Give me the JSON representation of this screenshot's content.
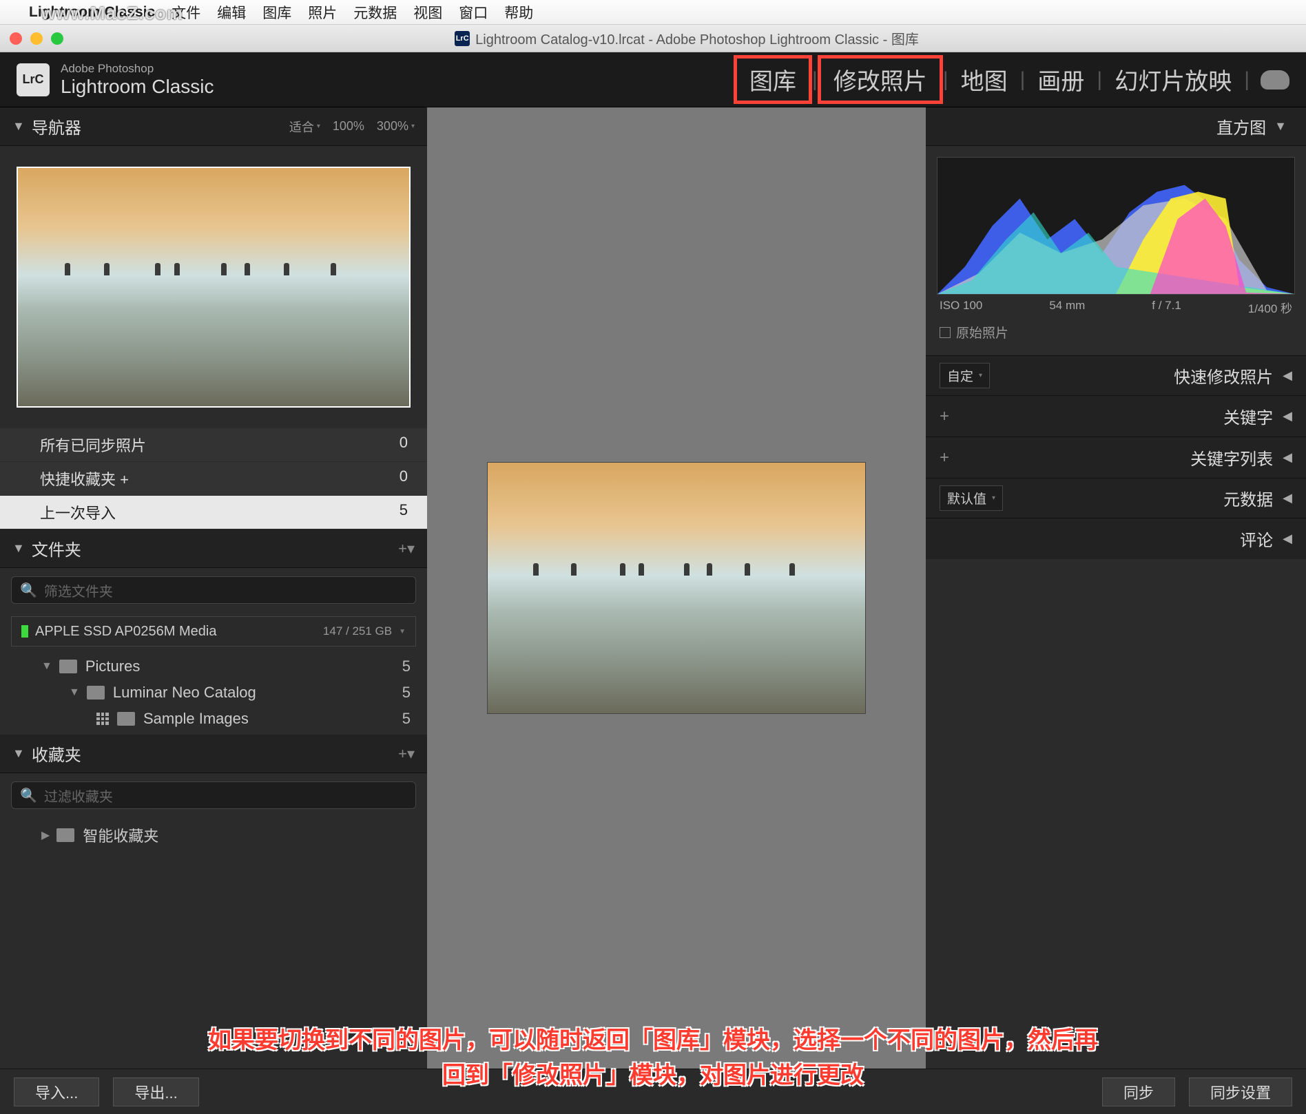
{
  "watermark": "www.MacZ.com",
  "menubar": {
    "apple": "",
    "app": "Lightroom Classic",
    "items": [
      "文件",
      "编辑",
      "图库",
      "照片",
      "元数据",
      "视图",
      "窗口",
      "帮助"
    ]
  },
  "titlebar": {
    "icon": "LrC",
    "title": "Lightroom Catalog-v10.lrcat - Adobe Photoshop Lightroom Classic - 图库"
  },
  "header": {
    "logo": "LrC",
    "brand_line1": "Adobe Photoshop",
    "brand_line2": "Lightroom Classic",
    "modules": [
      {
        "label": "图库",
        "highlighted": true
      },
      {
        "label": "修改照片",
        "highlighted": true
      },
      {
        "label": "地图",
        "highlighted": false
      },
      {
        "label": "画册",
        "highlighted": false
      },
      {
        "label": "幻灯片放映",
        "highlighted": false
      }
    ]
  },
  "left": {
    "navigator": {
      "title": "导航器",
      "zooms": [
        "适合",
        "100%",
        "300%"
      ]
    },
    "catalog": {
      "rows": [
        {
          "label": "所有已同步照片",
          "count": "0"
        },
        {
          "label": "快捷收藏夹 +",
          "count": "0"
        },
        {
          "label": "上一次导入",
          "count": "5",
          "selected": true
        }
      ]
    },
    "folders": {
      "title": "文件夹",
      "search_placeholder": "筛选文件夹",
      "volume": {
        "name": "APPLE SSD AP0256M Media",
        "capacity": "147 / 251 GB"
      },
      "tree": [
        {
          "indent": 1,
          "icon": "folder",
          "label": "Pictures",
          "count": "5"
        },
        {
          "indent": 2,
          "icon": "folder",
          "label": "Luminar Neo Catalog",
          "count": "5"
        },
        {
          "indent": 3,
          "icon": "grid",
          "label": "Sample Images",
          "count": "5"
        }
      ]
    },
    "collections": {
      "title": "收藏夹",
      "search_placeholder": "过滤收藏夹",
      "rows": [
        {
          "indent": 1,
          "icon": "smart",
          "label": "智能收藏夹"
        }
      ]
    }
  },
  "right": {
    "histogram": {
      "title": "直方图",
      "info": {
        "iso": "ISO 100",
        "focal": "54 mm",
        "aperture": "f / 7.1",
        "shutter": "1/400 秒"
      },
      "original": "原始照片"
    },
    "panels": [
      {
        "dropdown": "自定",
        "title": "快速修改照片"
      },
      {
        "plus": true,
        "title": "关键字"
      },
      {
        "plus": true,
        "title": "关键字列表"
      },
      {
        "dropdown": "默认值",
        "title": "元数据"
      },
      {
        "title": "评论"
      }
    ]
  },
  "bottom": {
    "import": "导入...",
    "export": "导出...",
    "sync": "同步",
    "sync_settings": "同步设置"
  },
  "annotation": {
    "line1": "如果要切换到不同的图片，可以随时返回「图库」模块，选择一个不同的图片，然后再",
    "line2": "回到「修改照片」模块，对图片进行更改"
  }
}
